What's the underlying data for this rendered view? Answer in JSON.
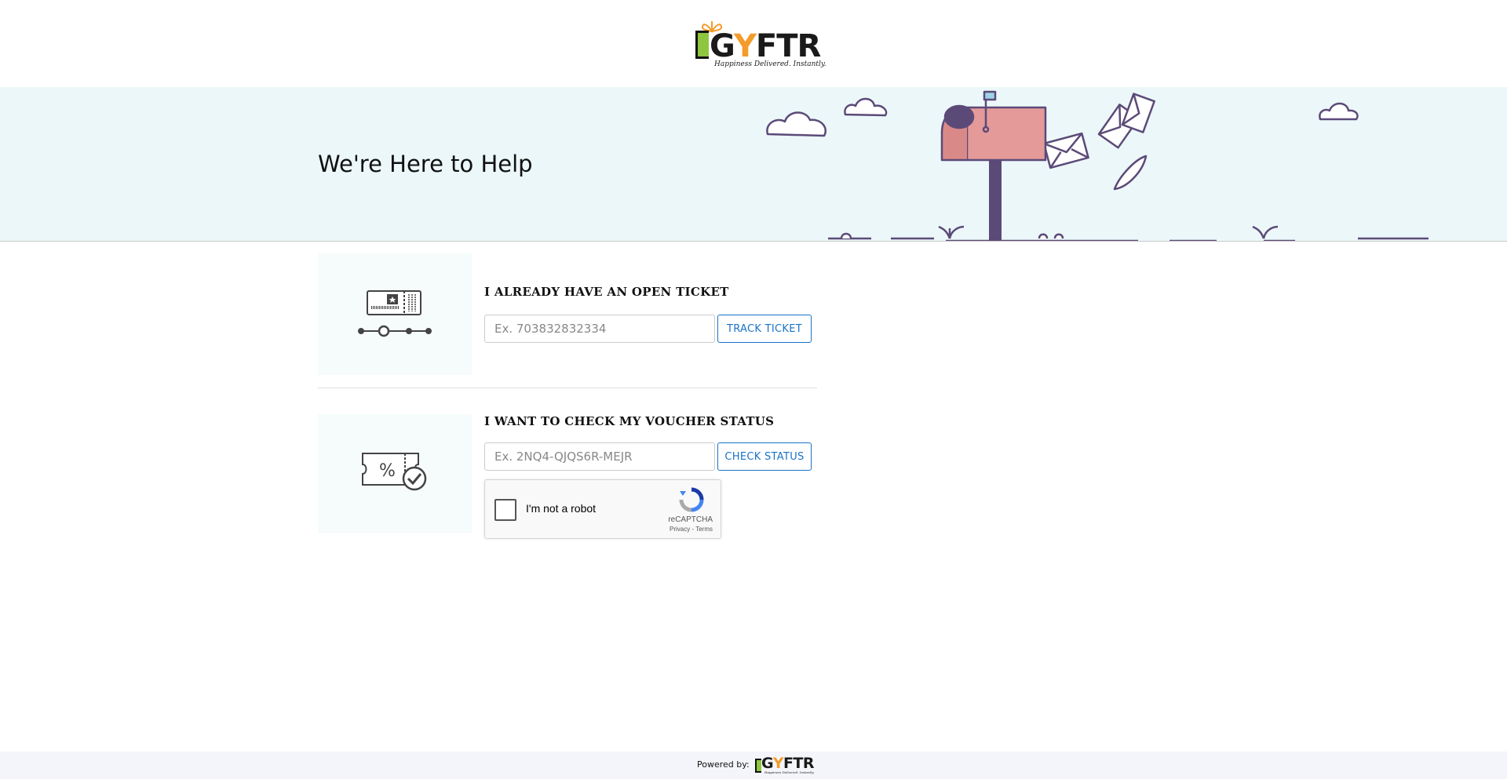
{
  "header": {
    "logo_text_pre": "G",
    "logo_text_y": "Y",
    "logo_text_post": "FTR",
    "logo_tagline": "Happiness Delivered. Instantly."
  },
  "banner": {
    "title": "We're Here to Help"
  },
  "ticket": {
    "title": "I ALREADY HAVE AN OPEN TICKET",
    "placeholder": "Ex. 703832832334",
    "button_label": "TRACK TICKET",
    "icon": "ticket-icon"
  },
  "voucher": {
    "title": "I WANT TO CHECK MY VOUCHER STATUS",
    "placeholder": "Ex. 2NQ4-QJQS6R-MEJR",
    "button_label": "CHECK STATUS",
    "icon": "voucher-discount-icon"
  },
  "captcha": {
    "label": "I'm not a robot",
    "brand": "reCAPTCHA",
    "links": "Privacy - Terms"
  },
  "footer": {
    "powered_by": "Powered by:",
    "logo_text_pre": "G",
    "logo_text_y": "Y",
    "logo_text_post": "FTR",
    "logo_tagline": "Happiness Delivered. Instantly."
  },
  "colors": {
    "accent": "#1a73c7",
    "banner_bg": "#ecf7f9",
    "logo_orange": "#f39c2b",
    "logo_green": "#8fc63f",
    "mailbox_red": "#e49a98",
    "illustration_purple": "#5b4a78"
  }
}
